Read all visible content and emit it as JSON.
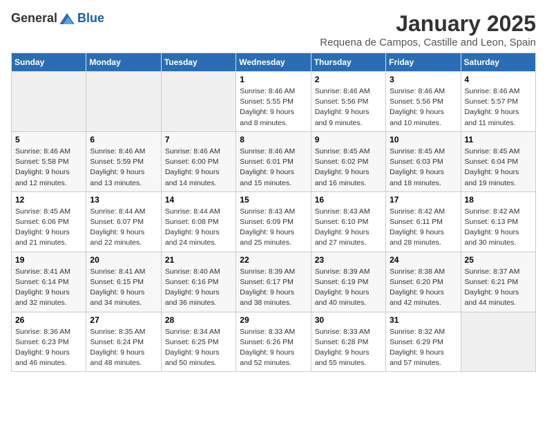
{
  "logo": {
    "text_general": "General",
    "text_blue": "Blue"
  },
  "title": "January 2025",
  "subtitle": "Requena de Campos, Castille and Leon, Spain",
  "headers": [
    "Sunday",
    "Monday",
    "Tuesday",
    "Wednesday",
    "Thursday",
    "Friday",
    "Saturday"
  ],
  "weeks": [
    [
      {
        "num": "",
        "info": ""
      },
      {
        "num": "",
        "info": ""
      },
      {
        "num": "",
        "info": ""
      },
      {
        "num": "1",
        "info": "Sunrise: 8:46 AM\nSunset: 5:55 PM\nDaylight: 9 hours and 8 minutes."
      },
      {
        "num": "2",
        "info": "Sunrise: 8:46 AM\nSunset: 5:56 PM\nDaylight: 9 hours and 9 minutes."
      },
      {
        "num": "3",
        "info": "Sunrise: 8:46 AM\nSunset: 5:56 PM\nDaylight: 9 hours and 10 minutes."
      },
      {
        "num": "4",
        "info": "Sunrise: 8:46 AM\nSunset: 5:57 PM\nDaylight: 9 hours and 11 minutes."
      }
    ],
    [
      {
        "num": "5",
        "info": "Sunrise: 8:46 AM\nSunset: 5:58 PM\nDaylight: 9 hours and 12 minutes."
      },
      {
        "num": "6",
        "info": "Sunrise: 8:46 AM\nSunset: 5:59 PM\nDaylight: 9 hours and 13 minutes."
      },
      {
        "num": "7",
        "info": "Sunrise: 8:46 AM\nSunset: 6:00 PM\nDaylight: 9 hours and 14 minutes."
      },
      {
        "num": "8",
        "info": "Sunrise: 8:46 AM\nSunset: 6:01 PM\nDaylight: 9 hours and 15 minutes."
      },
      {
        "num": "9",
        "info": "Sunrise: 8:45 AM\nSunset: 6:02 PM\nDaylight: 9 hours and 16 minutes."
      },
      {
        "num": "10",
        "info": "Sunrise: 8:45 AM\nSunset: 6:03 PM\nDaylight: 9 hours and 18 minutes."
      },
      {
        "num": "11",
        "info": "Sunrise: 8:45 AM\nSunset: 6:04 PM\nDaylight: 9 hours and 19 minutes."
      }
    ],
    [
      {
        "num": "12",
        "info": "Sunrise: 8:45 AM\nSunset: 6:06 PM\nDaylight: 9 hours and 21 minutes."
      },
      {
        "num": "13",
        "info": "Sunrise: 8:44 AM\nSunset: 6:07 PM\nDaylight: 9 hours and 22 minutes."
      },
      {
        "num": "14",
        "info": "Sunrise: 8:44 AM\nSunset: 6:08 PM\nDaylight: 9 hours and 24 minutes."
      },
      {
        "num": "15",
        "info": "Sunrise: 8:43 AM\nSunset: 6:09 PM\nDaylight: 9 hours and 25 minutes."
      },
      {
        "num": "16",
        "info": "Sunrise: 8:43 AM\nSunset: 6:10 PM\nDaylight: 9 hours and 27 minutes."
      },
      {
        "num": "17",
        "info": "Sunrise: 8:42 AM\nSunset: 6:11 PM\nDaylight: 9 hours and 28 minutes."
      },
      {
        "num": "18",
        "info": "Sunrise: 8:42 AM\nSunset: 6:13 PM\nDaylight: 9 hours and 30 minutes."
      }
    ],
    [
      {
        "num": "19",
        "info": "Sunrise: 8:41 AM\nSunset: 6:14 PM\nDaylight: 9 hours and 32 minutes."
      },
      {
        "num": "20",
        "info": "Sunrise: 8:41 AM\nSunset: 6:15 PM\nDaylight: 9 hours and 34 minutes."
      },
      {
        "num": "21",
        "info": "Sunrise: 8:40 AM\nSunset: 6:16 PM\nDaylight: 9 hours and 36 minutes."
      },
      {
        "num": "22",
        "info": "Sunrise: 8:39 AM\nSunset: 6:17 PM\nDaylight: 9 hours and 38 minutes."
      },
      {
        "num": "23",
        "info": "Sunrise: 8:39 AM\nSunset: 6:19 PM\nDaylight: 9 hours and 40 minutes."
      },
      {
        "num": "24",
        "info": "Sunrise: 8:38 AM\nSunset: 6:20 PM\nDaylight: 9 hours and 42 minutes."
      },
      {
        "num": "25",
        "info": "Sunrise: 8:37 AM\nSunset: 6:21 PM\nDaylight: 9 hours and 44 minutes."
      }
    ],
    [
      {
        "num": "26",
        "info": "Sunrise: 8:36 AM\nSunset: 6:23 PM\nDaylight: 9 hours and 46 minutes."
      },
      {
        "num": "27",
        "info": "Sunrise: 8:35 AM\nSunset: 6:24 PM\nDaylight: 9 hours and 48 minutes."
      },
      {
        "num": "28",
        "info": "Sunrise: 8:34 AM\nSunset: 6:25 PM\nDaylight: 9 hours and 50 minutes."
      },
      {
        "num": "29",
        "info": "Sunrise: 8:33 AM\nSunset: 6:26 PM\nDaylight: 9 hours and 52 minutes."
      },
      {
        "num": "30",
        "info": "Sunrise: 8:33 AM\nSunset: 6:28 PM\nDaylight: 9 hours and 55 minutes."
      },
      {
        "num": "31",
        "info": "Sunrise: 8:32 AM\nSunset: 6:29 PM\nDaylight: 9 hours and 57 minutes."
      },
      {
        "num": "",
        "info": ""
      }
    ]
  ]
}
